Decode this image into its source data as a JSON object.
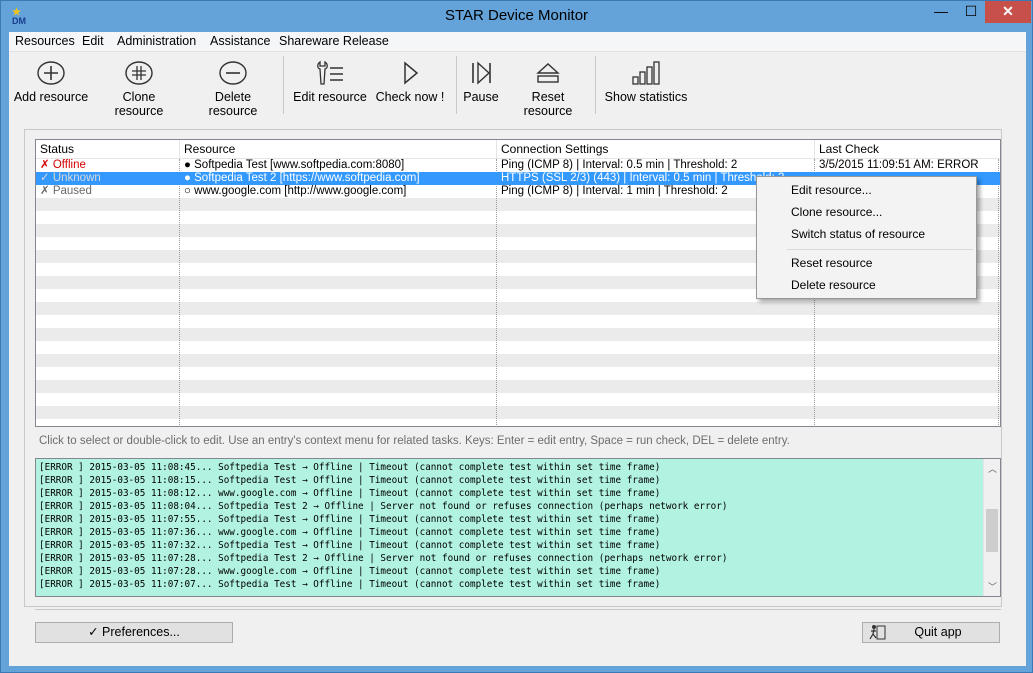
{
  "window": {
    "title": "STAR Device Monitor",
    "icon_text": "DM",
    "min_glyph": "—",
    "max_glyph": "☐",
    "close_glyph": "✕"
  },
  "menu": [
    "Resources",
    "Edit",
    "Administration",
    "Assistance",
    "Shareware Release"
  ],
  "toolbar": {
    "add": "Add resource",
    "clone": "Clone resource",
    "delete": "Delete resource",
    "edit": "Edit resource",
    "check": "Check now !",
    "pause": "Pause",
    "reset": "Reset resource",
    "stats": "Show statistics"
  },
  "grid": {
    "columns": [
      "Status",
      "Resource",
      "Connection Settings",
      "Last Check"
    ],
    "rows": [
      {
        "status": "✗ Offline",
        "resource": "● Softpedia Test [www.softpedia.com:8080]",
        "settings": "Ping (ICMP 8) | Interval: 0.5 min | Threshold: 2",
        "last": "3/5/2015 11:09:51 AM: ERROR"
      },
      {
        "status": "✓ Unknown",
        "resource": "● Softpedia Test 2 [https://www.softpedia.com]",
        "settings": "HTTPS (SSL 2/3) (443) | Interval: 0.5 min | Threshold: 2",
        "last": ""
      },
      {
        "status": "✗ Paused",
        "resource": "○ www.google.com [http://www.google.com]",
        "settings": "Ping (ICMP 8) | Interval: 1 min | Threshold: 2",
        "last": ""
      }
    ]
  },
  "context_menu": [
    "Edit resource...",
    "Clone resource...",
    "Switch status of resource",
    "Reset resource",
    "Delete resource"
  ],
  "hint": "Click to select or double-click to edit. Use an entry's context menu for related tasks. Keys: Enter = edit entry, Space = run check, DEL = delete entry.",
  "log": [
    "[ERROR ] 2015-03-05 11:08:45... Softpedia Test → Offline | Timeout (cannot complete test within set time frame)",
    "[ERROR ] 2015-03-05 11:08:15... Softpedia Test → Offline | Timeout (cannot complete test within set time frame)",
    "[ERROR ] 2015-03-05 11:08:12... www.google.com → Offline | Timeout (cannot complete test within set time frame)",
    "[ERROR ] 2015-03-05 11:08:04... Softpedia Test 2 → Offline | Server not found or refuses connection (perhaps network error)",
    "[ERROR ] 2015-03-05 11:07:55... Softpedia Test → Offline | Timeout (cannot complete test within set time frame)",
    "[ERROR ] 2015-03-05 11:07:36... www.google.com → Offline | Timeout (cannot complete test within set time frame)",
    "[ERROR ] 2015-03-05 11:07:32... Softpedia Test → Offline | Timeout (cannot complete test within set time frame)",
    "[ERROR ] 2015-03-05 11:07:28... Softpedia Test 2 → Offline | Server not found or refuses connection (perhaps network error)",
    "[ERROR ] 2015-03-05 11:07:28... www.google.com → Offline | Timeout (cannot complete test within set time frame)",
    "[ERROR ] 2015-03-05 11:07:07... Softpedia Test → Offline | Timeout (cannot complete test within set time frame)"
  ],
  "buttons": {
    "preferences": "✓ Preferences...",
    "quit": "Quit app"
  },
  "colors": {
    "titlebar": "#64a3d9",
    "close": "#c7504b",
    "selection": "#3399ff",
    "log_bg": "#b1f2e0",
    "offline": "#d40000"
  }
}
